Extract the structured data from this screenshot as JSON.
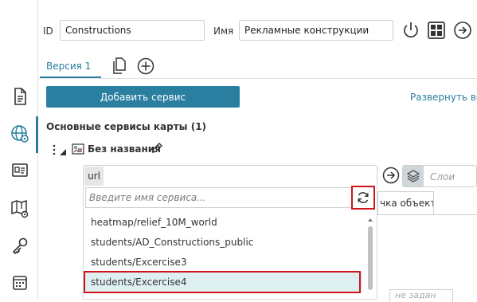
{
  "header": {
    "id_label": "ID",
    "id_value": "Constructions",
    "name_label": "Имя",
    "name_value": "Рекламные конструкции"
  },
  "tabs": {
    "version_label": "Версия 1"
  },
  "toolbar": {
    "add_service_label": "Добавить сервис",
    "expand_link": "Развернуть во"
  },
  "section": {
    "title": "Основные сервисы карты (1)"
  },
  "layer": {
    "name": "Без названия"
  },
  "url_row": {
    "tag": "url",
    "layers_placeholder": "Слои"
  },
  "dropdown": {
    "search_placeholder": "Введите имя сервиса...",
    "items": [
      {
        "label": "heatmap/relief_10M_world"
      },
      {
        "label": "students/AD_Constructions_public"
      },
      {
        "label": "students/Excercise3"
      },
      {
        "label": "students/Excercise4"
      }
    ],
    "selected_index": 3
  },
  "behind": {
    "tab_label": "чка объекта",
    "bottom_text": "не задан"
  },
  "colors": {
    "accent": "#2a7fa0",
    "highlight": "#d0141b",
    "selected_bg": "#dff0f3"
  },
  "icons": {
    "sidebar": [
      "document-icon",
      "globe-settings-icon",
      "id-card-icon",
      "map-settings-icon",
      "key-icon",
      "grid-calendar-icon"
    ],
    "header": [
      "power-icon",
      "grid-icon",
      "arrow-right-circle-icon"
    ],
    "tabs": [
      "copy-icon",
      "add-circle-icon"
    ]
  }
}
